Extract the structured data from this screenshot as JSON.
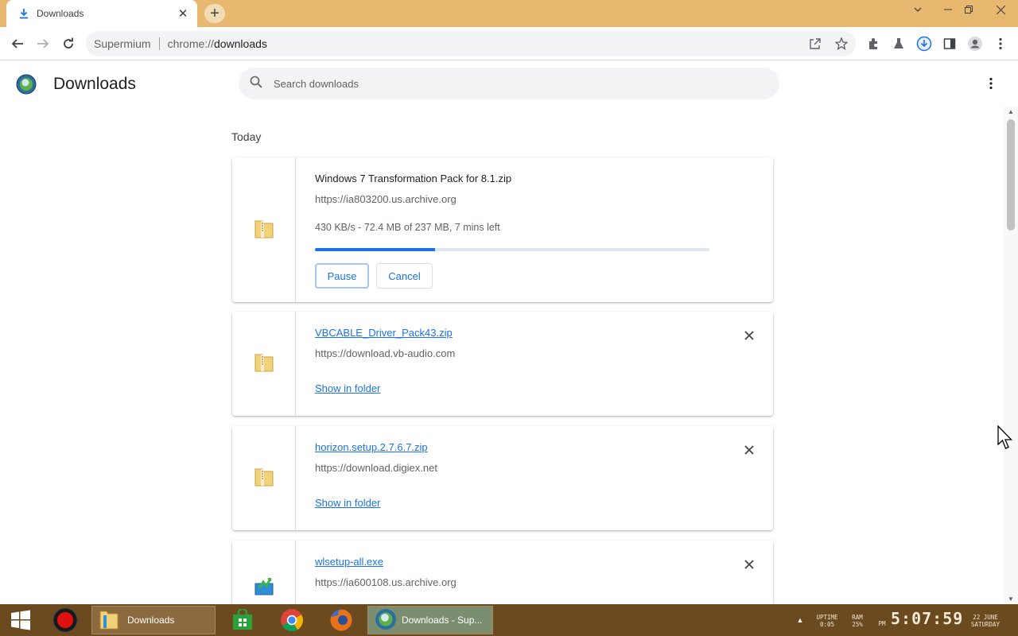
{
  "browser": {
    "tab_title": "Downloads",
    "site_name": "Supermium",
    "url_scheme": "chrome://",
    "url_path": "downloads"
  },
  "page": {
    "title": "Downloads",
    "search_placeholder": "Search downloads",
    "section_date": "Today"
  },
  "downloads": [
    {
      "file_name": "Windows 7 Transformation Pack for 8.1.zip",
      "url": "https://ia803200.us.archive.org",
      "status": "430 KB/s - 72.4 MB of 237 MB, 7 mins left",
      "progress": 0.305,
      "pause_label": "Pause",
      "cancel_label": "Cancel",
      "icon": "zip-folder-icon"
    },
    {
      "file_name": "VBCABLE_Driver_Pack43.zip",
      "url": "https://download.vb-audio.com",
      "show_in_folder": "Show in folder",
      "icon": "zip-folder-icon"
    },
    {
      "file_name": "horizon.setup.2.7.6.7.zip",
      "url": "https://download.digiex.net",
      "show_in_folder": "Show in folder",
      "icon": "zip-folder-icon"
    },
    {
      "file_name": "wlsetup-all.exe",
      "url": "https://ia600108.us.archive.org",
      "icon": "installer-icon"
    }
  ],
  "taskbar": {
    "downloads_label": "Downloads",
    "chrome_label": "Downloads - Sup...",
    "uptime_label": "UPTIME",
    "uptime_value": "0:05",
    "ram_label": "RAM",
    "ram_value": "25%",
    "ampm": "PM",
    "time": "5:07:59",
    "date": "22 JUNE",
    "weekday": "SATURDAY"
  },
  "colors": {
    "titlebar": "#e8b870",
    "accent": "#1a73e8",
    "taskbar": "#6b4a20"
  }
}
